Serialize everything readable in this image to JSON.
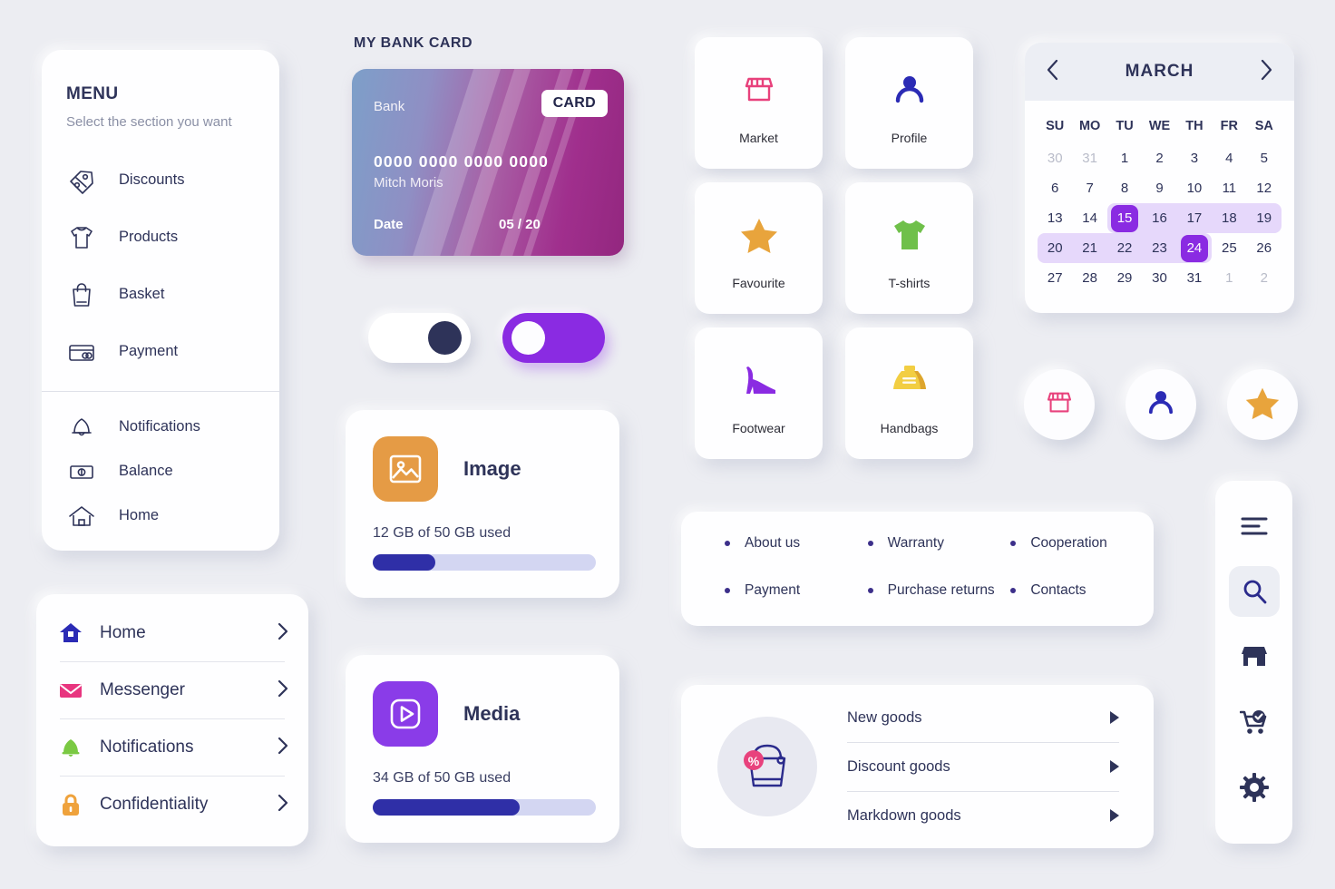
{
  "theme": {
    "bg": "#ecedf2",
    "card_bg": "#fefeff",
    "ink": "#2e3359",
    "accent_purple": "#8a2be2",
    "accent_indigo": "#2f2fa7",
    "range_lavender": "#e6d8fb",
    "muted": "#8b90a6"
  },
  "menu": {
    "title": "MENU",
    "subtitle": "Select the section you want",
    "group_one": [
      {
        "label": "Discounts",
        "icon": "price-tag-icon"
      },
      {
        "label": "Products",
        "icon": "tshirt-outline-icon"
      },
      {
        "label": "Basket",
        "icon": "shopping-bag-outline-icon"
      },
      {
        "label": "Payment",
        "icon": "credit-card-outline-icon"
      }
    ],
    "group_two": [
      {
        "label": "Notifications",
        "icon": "bell-outline-icon"
      },
      {
        "label": "Balance",
        "icon": "banknote-outline-icon"
      },
      {
        "label": "Home",
        "icon": "home-outline-icon"
      }
    ]
  },
  "navlist": {
    "items": [
      {
        "label": "Home",
        "icon": "home-filled-icon",
        "color": "#2b2bb5"
      },
      {
        "label": "Messenger",
        "icon": "envelope-icon",
        "color": "#e8357f"
      },
      {
        "label": "Notifications",
        "icon": "bell-filled-icon",
        "color": "#7ac943"
      },
      {
        "label": "Confidentiality",
        "icon": "lock-icon",
        "color": "#efa23c"
      }
    ],
    "chevron_icon": "chevron-right-icon"
  },
  "bank_card": {
    "section_title": "MY BANK CARD",
    "bank_label": "Bank",
    "badge": "CARD",
    "number": "0000 0000 0000 0000",
    "holder": "Mitch Moris",
    "date_label": "Date",
    "date_value": "05 / 20",
    "gradient_from": "#7d9fc9",
    "gradient_to": "#93277f"
  },
  "toggles": [
    {
      "name": "toggle-off",
      "state": "off",
      "track": "#ffffff",
      "knob": "#2e3359"
    },
    {
      "name": "toggle-on",
      "state": "on",
      "track": "#8a2be2",
      "knob": "#fdfdff"
    }
  ],
  "storage": [
    {
      "title": "Image",
      "used_text": "12 GB of 50 GB used",
      "percent": 28,
      "icon": "image-icon",
      "icon_bg": "#e59b45"
    },
    {
      "title": "Media",
      "used_text": "34 GB of 50 GB used",
      "percent": 66,
      "icon": "play-square-icon",
      "icon_bg": "#8a3ce8"
    }
  ],
  "categories": [
    {
      "label": "Market",
      "icon": "store-outline-icon",
      "color": "#e8417c"
    },
    {
      "label": "Profile",
      "icon": "user-icon",
      "color": "#2b2bb5"
    },
    {
      "label": "Favourite",
      "icon": "star-icon",
      "color": "#e8a43c"
    },
    {
      "label": "T-shirts",
      "icon": "tshirt-filled-icon",
      "color": "#6fc04a"
    },
    {
      "label": "Footwear",
      "icon": "high-heel-icon",
      "color": "#8a2be2"
    },
    {
      "label": "Handbags",
      "icon": "handbag-icon",
      "color": "#f2ce42"
    }
  ],
  "calendar": {
    "month": "MARCH",
    "prev_icon": "chevron-left-icon",
    "next_icon": "chevron-right-icon",
    "dow": [
      "SU",
      "MO",
      "TU",
      "WE",
      "TH",
      "FR",
      "SA"
    ],
    "weeks": [
      [
        {
          "d": "30",
          "muted": true
        },
        {
          "d": "31",
          "muted": true
        },
        {
          "d": "1"
        },
        {
          "d": "2"
        },
        {
          "d": "3"
        },
        {
          "d": "4"
        },
        {
          "d": "5"
        }
      ],
      [
        {
          "d": "6"
        },
        {
          "d": "7"
        },
        {
          "d": "8"
        },
        {
          "d": "9"
        },
        {
          "d": "10"
        },
        {
          "d": "11"
        },
        {
          "d": "12"
        }
      ],
      [
        {
          "d": "13"
        },
        {
          "d": "14"
        },
        {
          "d": "15",
          "selected": true,
          "range": true,
          "range_start": true
        },
        {
          "d": "16",
          "range": true
        },
        {
          "d": "17",
          "range": true
        },
        {
          "d": "18",
          "range": true
        },
        {
          "d": "19",
          "range": true,
          "range_end": true
        }
      ],
      [
        {
          "d": "20",
          "range": true,
          "range_start": true
        },
        {
          "d": "21",
          "range": true
        },
        {
          "d": "22",
          "range": true
        },
        {
          "d": "23",
          "range": true
        },
        {
          "d": "24",
          "selected": true,
          "range": true,
          "range_end": true
        },
        {
          "d": "25"
        },
        {
          "d": "26"
        }
      ],
      [
        {
          "d": "27"
        },
        {
          "d": "28"
        },
        {
          "d": "29"
        },
        {
          "d": "30"
        },
        {
          "d": "31"
        },
        {
          "d": "1",
          "muted": true
        },
        {
          "d": "2",
          "muted": true
        }
      ]
    ],
    "selected_range": {
      "start": 15,
      "end": 24
    }
  },
  "circle_buttons": [
    {
      "icon": "store-outline-icon",
      "color": "#e8417c"
    },
    {
      "icon": "user-icon",
      "color": "#2b2bb5"
    },
    {
      "icon": "star-icon",
      "color": "#e8a43c"
    }
  ],
  "footer_links": [
    "About us",
    "Warranty",
    "Cooperation",
    "Payment",
    "Purchase returns",
    "Contacts"
  ],
  "goods": {
    "icon": "discount-basket-icon",
    "badge_text": "%",
    "items": [
      "New goods",
      "Discount goods",
      "Markdown goods"
    ],
    "arrow_icon": "triangle-right-icon"
  },
  "iconbar": [
    {
      "icon": "hamburger-menu-icon",
      "active": false
    },
    {
      "icon": "search-icon",
      "active": true
    },
    {
      "icon": "store-filled-icon",
      "active": false
    },
    {
      "icon": "cart-check-icon",
      "active": false
    },
    {
      "icon": "gear-icon",
      "active": false
    }
  ]
}
